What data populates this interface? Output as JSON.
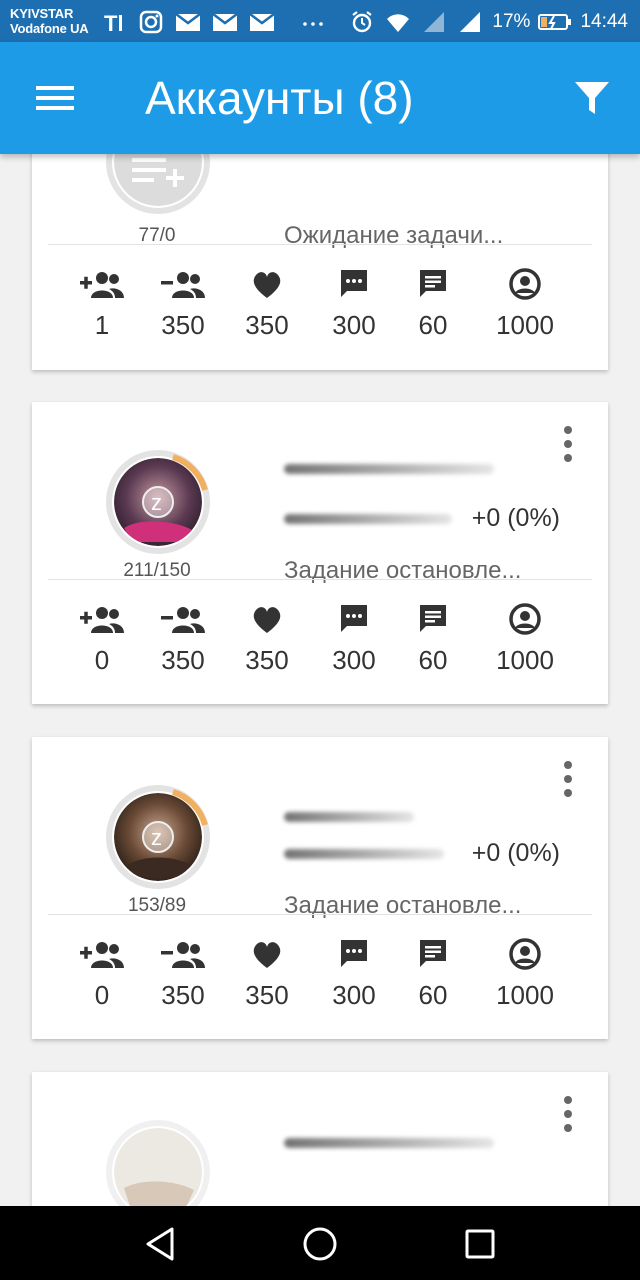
{
  "status_bar": {
    "carrier1": "KYIVSTAR",
    "carrier2": "Vodafone UA",
    "battery": "17%",
    "time": "14:44",
    "icons": [
      "T-icon",
      "instagram-icon",
      "mail-icon",
      "mail-icon",
      "mail-icon",
      "more-dots-icon",
      "alarm-icon",
      "wifi-icon",
      "signal-icon",
      "signal-icon",
      "battery-icon"
    ]
  },
  "appbar": {
    "title": "Аккаунты (8)"
  },
  "colors": {
    "appbar": "#1e9be6",
    "statusbar": "#1d6fb1",
    "accent_arc": "#f0b060"
  },
  "cards": [
    {
      "counts": "77/0",
      "status": "Ожидание задачи...",
      "stats": [
        "1",
        "350",
        "350",
        "300",
        "60",
        "1000"
      ]
    },
    {
      "counts": "211/150",
      "status": "Задание остановле...",
      "balance": "+0 (0%)",
      "stats": [
        "0",
        "350",
        "350",
        "300",
        "60",
        "1000"
      ]
    },
    {
      "counts": "153/89",
      "status": "Задание остановле...",
      "balance": "+0 (0%)",
      "stats": [
        "0",
        "350",
        "350",
        "300",
        "60",
        "1000"
      ]
    }
  ]
}
